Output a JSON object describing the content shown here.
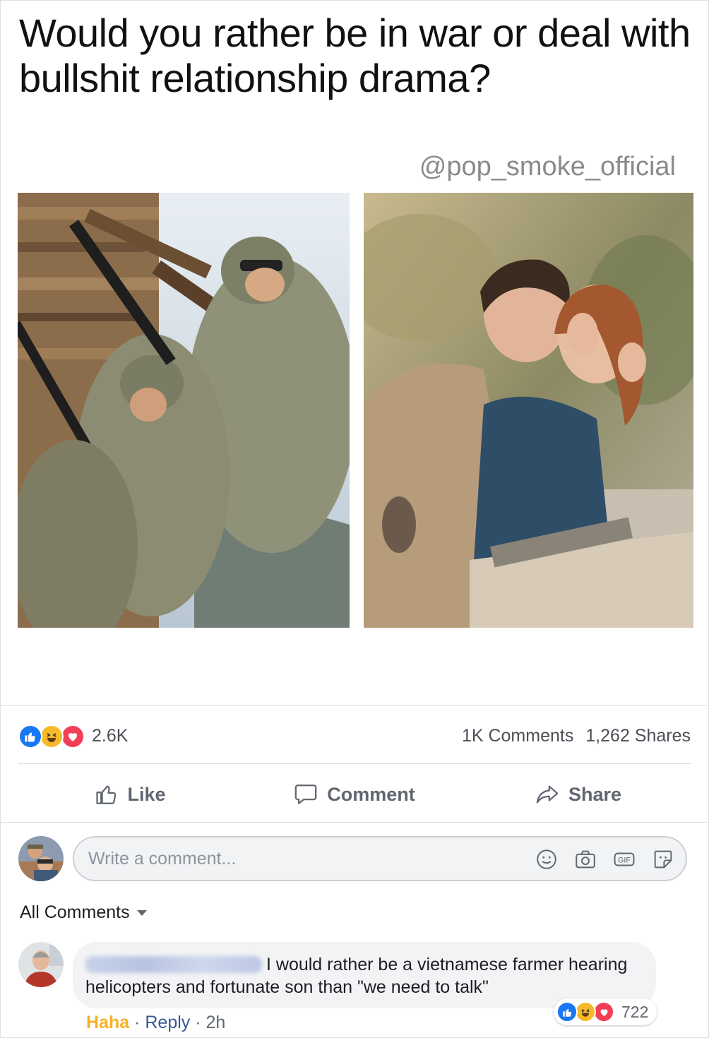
{
  "post": {
    "meme_title": "Would you rather be in war or deal with bullshit relationship drama?",
    "meme_handle": "@pop_smoke_official"
  },
  "stats": {
    "reaction_count": "2.6K",
    "comments": "1K Comments",
    "shares": "1,262 Shares"
  },
  "actions": {
    "like": "Like",
    "comment": "Comment",
    "share": "Share"
  },
  "composer": {
    "placeholder": "Write a comment...",
    "icons": [
      "emoji-icon",
      "camera-icon",
      "gif-icon",
      "sticker-icon"
    ]
  },
  "comments_section": {
    "sort_label": "All Comments"
  },
  "comment": {
    "text": "I would rather be a vietnamese farmer hearing helicopters and fortunate son than \"we need to talk\"",
    "reaction_count": "722",
    "reaction_label": "Haha",
    "reply_label": "Reply",
    "time": "2h",
    "separator": "·"
  },
  "colors": {
    "like_blue": "#1877f2",
    "haha_yellow": "#f7b928",
    "love_red": "#f33e58",
    "link_blue": "#385898"
  }
}
